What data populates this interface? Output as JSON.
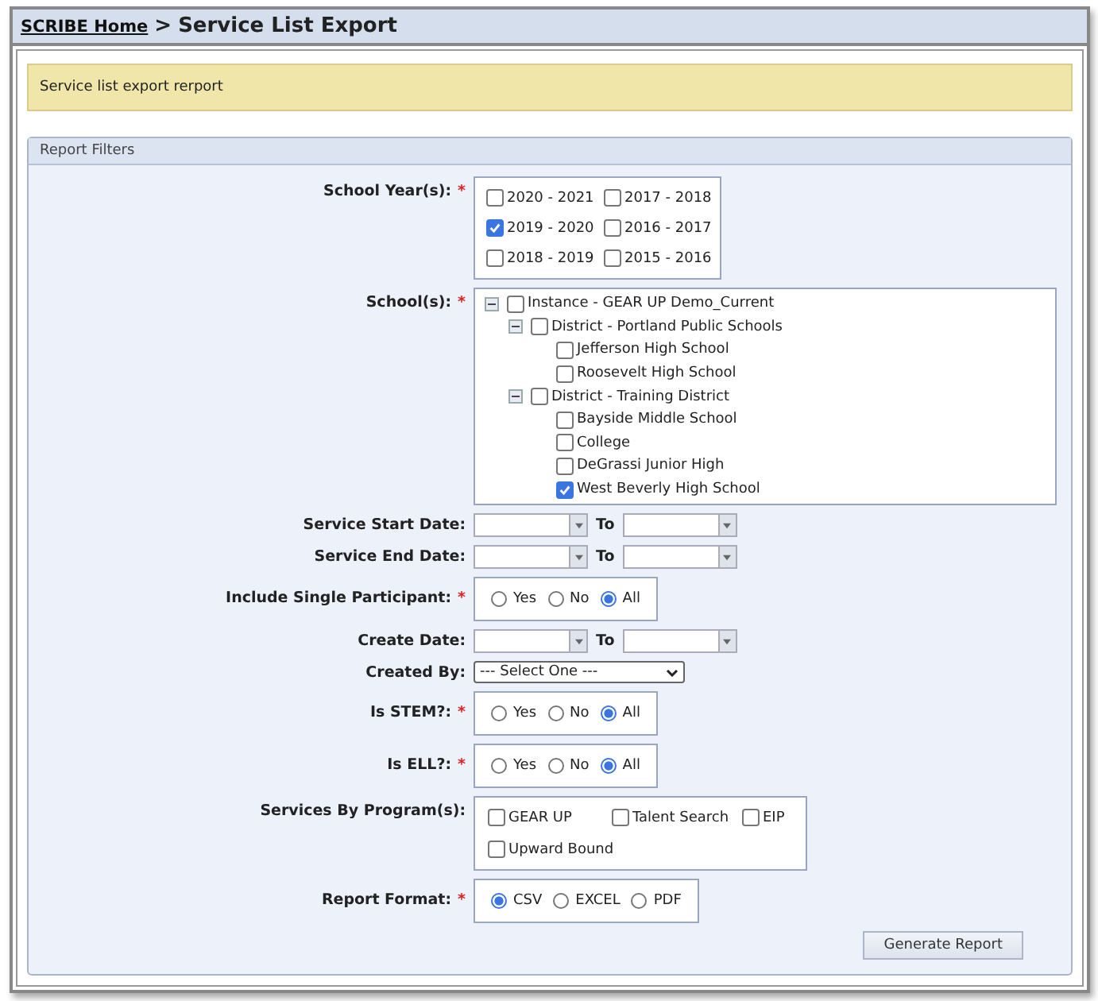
{
  "header": {
    "link": "SCRIBE Home",
    "separator": ">",
    "title": "Service List Export"
  },
  "notice": "Service list export rerport",
  "panel": {
    "title": "Report Filters"
  },
  "fields": [
    {
      "kind": "checkgrid",
      "label": "School Year(s):",
      "required_mark": "*",
      "options": [
        {
          "label": "2020 - 2021",
          "checked": false
        },
        {
          "label": "2017 - 2018",
          "checked": false
        },
        {
          "label": "2019 - 2020",
          "checked": true
        },
        {
          "label": "2016 - 2017",
          "checked": false
        },
        {
          "label": "2018 - 2019",
          "checked": false
        },
        {
          "label": "2015 - 2016",
          "checked": false
        }
      ]
    },
    {
      "kind": "tree",
      "label": "School(s):",
      "required_mark": "*",
      "nodes": [
        {
          "label": "Instance - GEAR UP Demo_Current",
          "checked": false,
          "expanded": true,
          "children": [
            {
              "label": "District - Portland Public Schools",
              "checked": false,
              "expanded": true,
              "children": [
                {
                  "label": "Jefferson High School",
                  "checked": false
                },
                {
                  "label": "Roosevelt High School",
                  "checked": false
                }
              ]
            },
            {
              "label": "District - Training District",
              "checked": false,
              "expanded": true,
              "children": [
                {
                  "label": "Bayside Middle School",
                  "checked": false
                },
                {
                  "label": "College",
                  "checked": false
                },
                {
                  "label": "DeGrassi Junior High",
                  "checked": false
                },
                {
                  "label": "West Beverly High School",
                  "checked": true
                }
              ]
            }
          ]
        }
      ]
    },
    {
      "kind": "daterange",
      "label": "Service Start Date:",
      "to_label": "To"
    },
    {
      "kind": "daterange",
      "label": "Service End Date:",
      "to_label": "To"
    },
    {
      "kind": "radio",
      "label": "Include Single Participant:",
      "required_mark": "*",
      "options": [
        {
          "label": "Yes",
          "selected": false
        },
        {
          "label": "No",
          "selected": false
        },
        {
          "label": "All",
          "selected": true
        }
      ]
    },
    {
      "kind": "daterange",
      "label": "Create Date:",
      "to_label": "To"
    },
    {
      "kind": "select",
      "label": "Created By:",
      "value": "--- Select One ---"
    },
    {
      "kind": "radio",
      "label": "Is STEM?:",
      "required_mark": "*",
      "options": [
        {
          "label": "Yes",
          "selected": false
        },
        {
          "label": "No",
          "selected": false
        },
        {
          "label": "All",
          "selected": true
        }
      ]
    },
    {
      "kind": "radio",
      "label": "Is ELL?:",
      "required_mark": "*",
      "options": [
        {
          "label": "Yes",
          "selected": false
        },
        {
          "label": "No",
          "selected": false
        },
        {
          "label": "All",
          "selected": true
        }
      ]
    },
    {
      "kind": "checklist",
      "label": "Services By Program(s):",
      "options": [
        {
          "label": "GEAR UP",
          "checked": false
        },
        {
          "label": "Talent Search",
          "checked": false
        },
        {
          "label": "EIP",
          "checked": false
        },
        {
          "label": "Upward Bound",
          "checked": false
        }
      ]
    },
    {
      "kind": "radio",
      "label": "Report Format:",
      "required_mark": "*",
      "options": [
        {
          "label": "CSV",
          "selected": true
        },
        {
          "label": "EXCEL",
          "selected": false
        },
        {
          "label": "PDF",
          "selected": false
        }
      ]
    }
  ],
  "button": "Generate Report"
}
